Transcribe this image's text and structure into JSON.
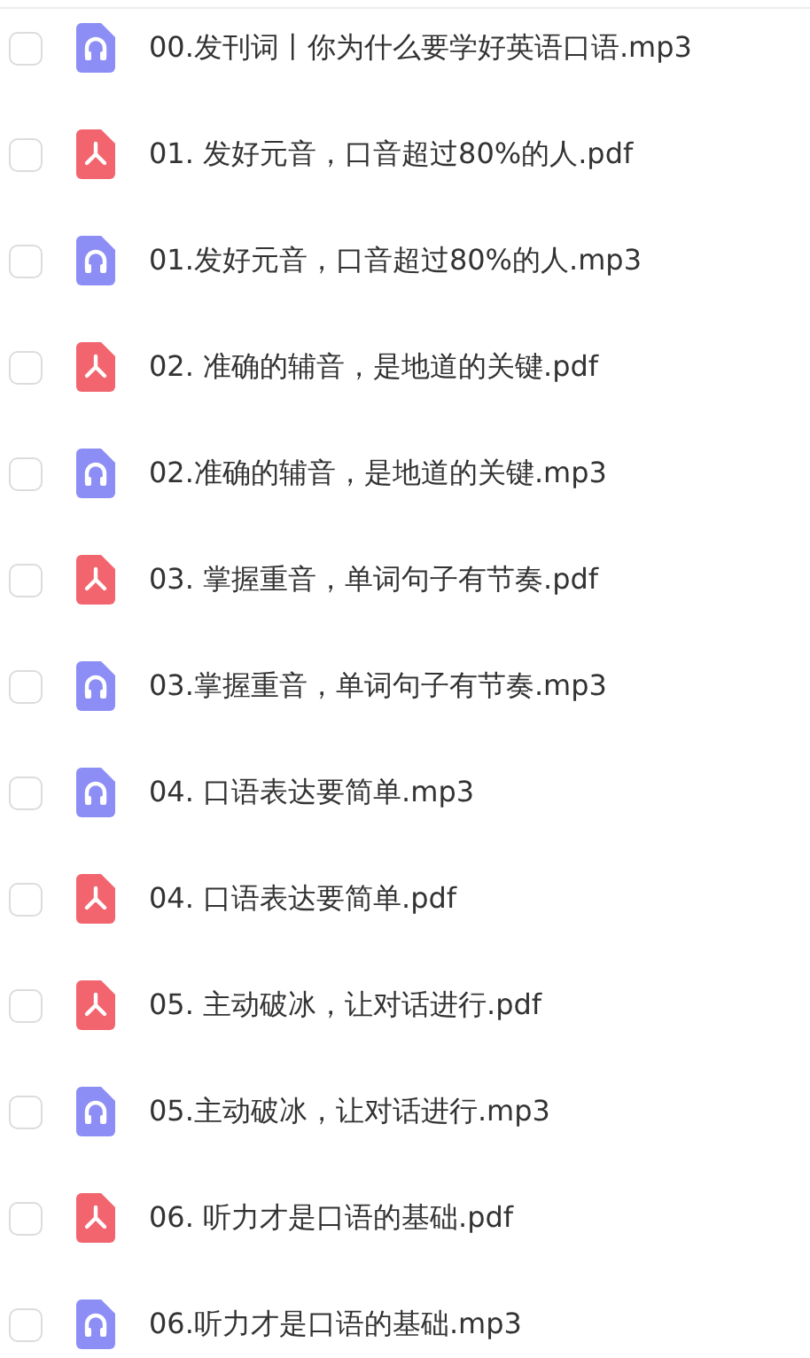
{
  "files": [
    {
      "name": "00.发刊词丨你为什么要学好英语口语.mp3",
      "kind": "audio",
      "checked": false
    },
    {
      "name": "01. 发好元音，口音超过80%的人.pdf",
      "kind": "pdf",
      "checked": false
    },
    {
      "name": "01.发好元音，口音超过80%的人.mp3",
      "kind": "audio",
      "checked": false
    },
    {
      "name": "02. 准确的辅音，是地道的关键.pdf",
      "kind": "pdf",
      "checked": false
    },
    {
      "name": "02.准确的辅音，是地道的关键.mp3",
      "kind": "audio",
      "checked": false
    },
    {
      "name": "03. 掌握重音，单词句子有节奏.pdf",
      "kind": "pdf",
      "checked": false
    },
    {
      "name": "03.掌握重音，单词句子有节奏.mp3",
      "kind": "audio",
      "checked": false
    },
    {
      "name": "04. 口语表达要简单.mp3",
      "kind": "audio",
      "checked": false
    },
    {
      "name": "04. 口语表达要简单.pdf",
      "kind": "pdf",
      "checked": false
    },
    {
      "name": "05. 主动破冰，让对话进行.pdf",
      "kind": "pdf",
      "checked": false
    },
    {
      "name": "05.主动破冰，让对话进行.mp3",
      "kind": "audio",
      "checked": false
    },
    {
      "name": "06. 听力才是口语的基础.pdf",
      "kind": "pdf",
      "checked": false
    },
    {
      "name": "06.听力才是口语的基础.mp3",
      "kind": "audio",
      "checked": false
    }
  ]
}
